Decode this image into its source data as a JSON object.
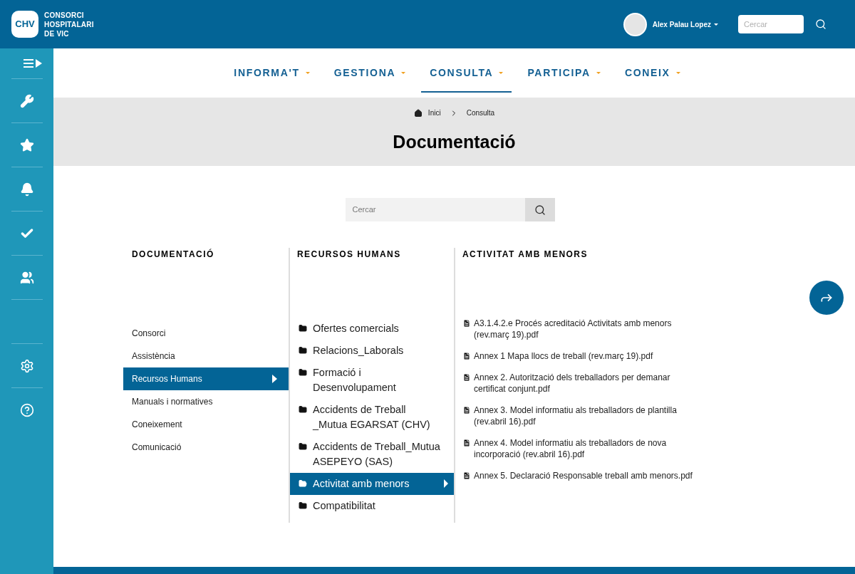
{
  "header": {
    "logo_mark": "CHV",
    "logo_lines": [
      "CONSORCI",
      "HOSPITALARI",
      "DE VIC"
    ],
    "user_name": "Alex Palau Lopez",
    "search": {
      "placeholder": "Cercar"
    }
  },
  "sidebar": {
    "items": [
      {
        "kind": "toggle"
      },
      {
        "kind": "wrench"
      },
      {
        "kind": "star"
      },
      {
        "kind": "bell"
      },
      {
        "kind": "check"
      },
      {
        "kind": "users"
      },
      {
        "kind": "empty"
      },
      {
        "kind": "gear"
      },
      {
        "kind": "help"
      }
    ]
  },
  "nav": [
    {
      "label": "INFORMA'T",
      "selected": false
    },
    {
      "label": "GESTIONA",
      "selected": false
    },
    {
      "label": "CONSULTA",
      "selected": true
    },
    {
      "label": "PARTICIPA",
      "selected": false
    },
    {
      "label": "CONEIX",
      "selected": false
    }
  ],
  "breadcrumb": [
    "Inici",
    "Consulta"
  ],
  "title": "Documentació",
  "search": {
    "placeholder": "Cercar"
  },
  "columns": [
    {
      "heading": "DOCUMENTACIÓ",
      "items": [
        {
          "label": "Consorci",
          "selected": false
        },
        {
          "label": "Assistència",
          "selected": false
        },
        {
          "label": "Recursos Humans",
          "selected": true
        },
        {
          "label": "Manuals i normatives",
          "selected": false
        },
        {
          "label": "Coneixement",
          "selected": false
        },
        {
          "label": "Comunicació",
          "selected": false
        }
      ]
    },
    {
      "heading": "RECURSOS HUMANS",
      "items": [
        {
          "label": "Ofertes comercials",
          "selected": false
        },
        {
          "label": "Relacions_Laborals",
          "selected": false
        },
        {
          "label": "Formació i Desenvolupament",
          "selected": false
        },
        {
          "label": "Accidents de Treball _Mutua EGARSAT (CHV)",
          "selected": false
        },
        {
          "label": "Accidents de Treball_Mutua ASEPEYO (SAS)",
          "selected": false
        },
        {
          "label": "Activitat amb menors",
          "selected": true
        },
        {
          "label": "Compatibilitat",
          "selected": false
        }
      ]
    },
    {
      "heading": "ACTIVITAT AMB MENORS",
      "files": [
        "A3.1.4.2.e Procés acreditació Activitats amb menors (rev.març 19).pdf",
        "Annex 1 Mapa llocs de treball (rev.març 19).pdf",
        "Annex 2. Autorització dels treballadors per demanar certificat conjunt.pdf",
        "Annex 3. Model informatiu als treballadors de plantilla (rev.abril 16).pdf",
        "Annex 4. Model informatiu als treballadors de nova incorporació (rev.abril 16).pdf",
        "Annex 5. Declaració Responsable treball amb menors.pdf"
      ]
    }
  ]
}
